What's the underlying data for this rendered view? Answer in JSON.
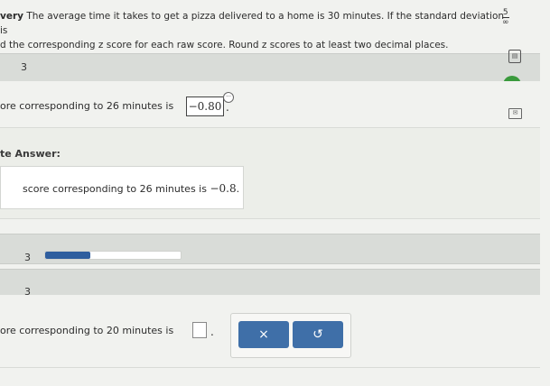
{
  "problem": {
    "lead": "very",
    "line1": " The average time it takes to get a pizza delivered to a home is 30 minutes. If the standard deviation is ",
    "frac_num": "5",
    "frac_den": "∞",
    "line2": "d the corresponding z score for each raw score. Round z scores to at least two decimal places."
  },
  "part1": {
    "number": "3",
    "prompt": "ore corresponding to 26 minutes is",
    "answer_value": "−0.80",
    "suffix": "."
  },
  "correct": {
    "heading": "te Answer:",
    "text": "score corresponding to 26 minutes is ",
    "value": "−0.8",
    "suffix": "."
  },
  "part2": {
    "number": "3",
    "progress": 0.33
  },
  "part3": {
    "number": "3",
    "prompt": "ore corresponding to 20 minutes is",
    "suffix": "."
  },
  "buttons": {
    "clear": "×",
    "undo": "↺"
  },
  "icons": {
    "check": "✓",
    "dots": "···",
    "calc": "▤",
    "mail": "✉"
  },
  "colors": {
    "accent": "#3f6fa8",
    "success": "#3a9a3c"
  }
}
